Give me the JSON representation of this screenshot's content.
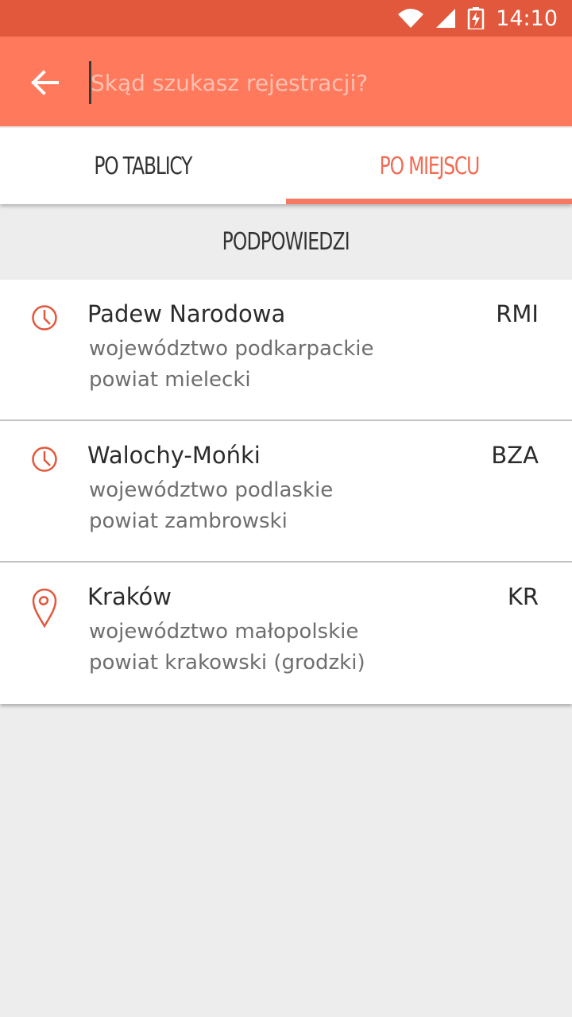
{
  "status_bar": {
    "time": "14:10"
  },
  "toolbar": {
    "search_placeholder": "Skąd szukasz rejestracji?"
  },
  "tabs": [
    {
      "label": "PO TABLICY",
      "active": false
    },
    {
      "label": "PO MIEJSCU",
      "active": true
    }
  ],
  "hints": {
    "header": "PODPOWIEDZI",
    "items": [
      {
        "icon": "clock-icon",
        "name": "Padew Narodowa",
        "code": "RMI",
        "line1": "województwo podkarpackie",
        "line2": "powiat mielecki"
      },
      {
        "icon": "clock-icon",
        "name": "Walochy-Mońki",
        "code": "BZA",
        "line1": "województwo podlaskie",
        "line2": "powiat zambrowski"
      },
      {
        "icon": "map-pin-icon",
        "name": "Kraków",
        "code": "KR",
        "line1": "województwo małopolskie",
        "line2": "powiat krakowski (grodzki)"
      }
    ]
  },
  "colors": {
    "accent": "#ff7a5d",
    "status_bar": "#e2583c",
    "active_tab": "#f26b52",
    "background": "#ededed"
  }
}
